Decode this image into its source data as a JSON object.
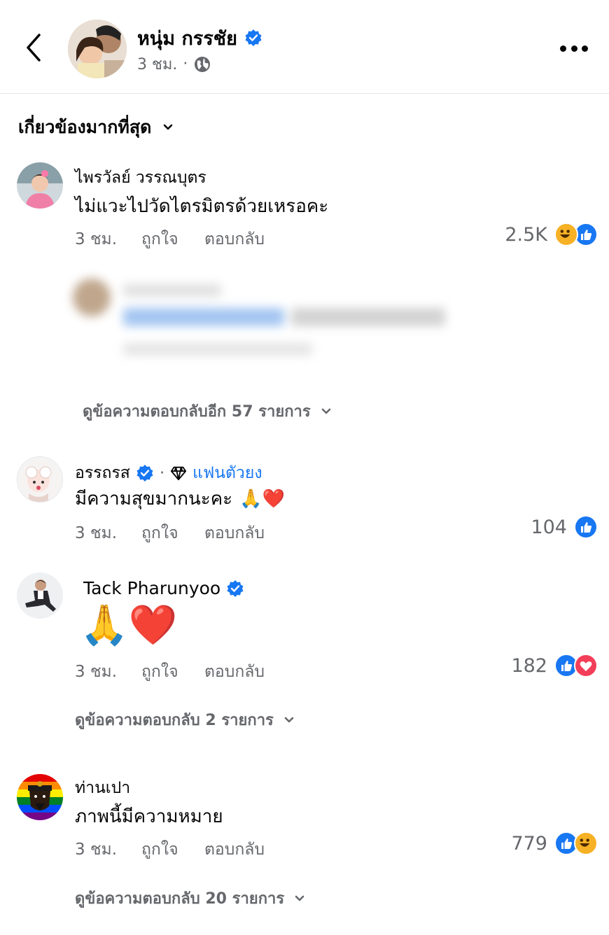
{
  "header": {
    "page_name": "หนุ่ม กรรชัย",
    "time": "3 ชม.",
    "separator": "·"
  },
  "sort": {
    "label": "เกี่ยวข้องมากที่สุด"
  },
  "actions": {
    "like": "ถูกใจ",
    "reply": "ตอบกลับ"
  },
  "comments": [
    {
      "name": "ไพรวัลย์ วรรณบุตร",
      "text": "ไม่แวะไปวัดไตรมิตรด้วยเหรอคะ",
      "time": "3 ชม.",
      "reaction_count": "2.5K",
      "reactions": [
        "haha",
        "like"
      ],
      "view_replies": "ดูข้อความตอบกลับอีก 57 รายการ"
    },
    {
      "name": "อรรถรส",
      "badge": "แฟนตัวยง",
      "separator": "·",
      "text": "มีความสุขมากนะคะ",
      "text_emoji": "🙏❤️",
      "time": "3 ชม.",
      "reaction_count": "104",
      "reactions": [
        "like"
      ]
    },
    {
      "name": "Tack Pharunyoo",
      "text_emoji": "🙏❤️",
      "time": "3 ชม.",
      "reaction_count": "182",
      "reactions": [
        "like",
        "love"
      ],
      "view_replies": "ดูข้อความตอบกลับ 2 รายการ"
    },
    {
      "name": "ท่านเปา",
      "text": "ภาพนี้มีความหมาย",
      "time": "3 ชม.",
      "reaction_count": "779",
      "reactions": [
        "like",
        "haha"
      ],
      "view_replies": "ดูข้อความตอบกลับ 20 รายการ"
    }
  ],
  "colors": {
    "facebook_blue": "#1877f2",
    "secondary_text": "#65676b",
    "love_red": "#f33e58",
    "haha_yellow": "#f7b125"
  }
}
